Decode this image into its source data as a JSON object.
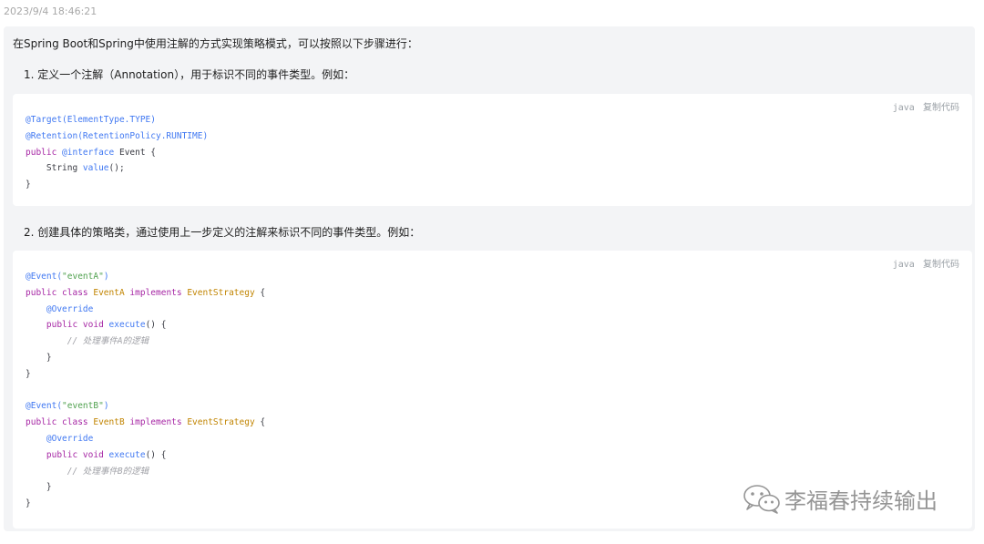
{
  "timestamp": "2023/9/4 18:46:21",
  "message": {
    "intro": "在Spring Boot和Spring中使用注解的方式实现策略模式，可以按照以下步骤进行：",
    "steps": [
      {
        "label": "1. 定义一个注解（Annotation），用于标识不同的事件类型。例如："
      },
      {
        "label": "2. 创建具体的策略类，通过使用上一步定义的注解来标识不同的事件类型。例如："
      }
    ],
    "code_blocks": [
      {
        "language": "java",
        "copy_label": "复制代码",
        "lines": [
          [
            [
              "t-anno",
              "@Target(ElementType.TYPE)"
            ]
          ],
          [
            [
              "t-anno",
              "@Retention(RetentionPolicy.RUNTIME)"
            ]
          ],
          [
            [
              "t-kw",
              "public "
            ],
            [
              "t-anno",
              "@interface"
            ],
            [
              "t-plain",
              " Event {"
            ]
          ],
          [
            [
              "t-plain",
              "    String "
            ],
            [
              "t-fn",
              "value"
            ],
            [
              "t-plain",
              "();"
            ]
          ],
          [
            [
              "t-plain",
              "}"
            ]
          ]
        ]
      },
      {
        "language": "java",
        "copy_label": "复制代码",
        "lines": [
          [
            [
              "t-anno",
              "@Event("
            ],
            [
              "t-str",
              "\"eventA\""
            ],
            [
              "t-anno",
              ")"
            ]
          ],
          [
            [
              "t-kw",
              "public class "
            ],
            [
              "t-type",
              "EventA"
            ],
            [
              "t-kw",
              " implements "
            ],
            [
              "t-type",
              "EventStrategy"
            ],
            [
              "t-plain",
              " {"
            ]
          ],
          [
            [
              "t-plain",
              "    "
            ],
            [
              "t-anno",
              "@Override"
            ]
          ],
          [
            [
              "t-plain",
              "    "
            ],
            [
              "t-kw",
              "public void "
            ],
            [
              "t-fn",
              "execute"
            ],
            [
              "t-plain",
              "() {"
            ]
          ],
          [
            [
              "t-plain",
              "        "
            ],
            [
              "t-cmt",
              "// 处理事件A的逻辑"
            ]
          ],
          [
            [
              "t-plain",
              "    }"
            ]
          ],
          [
            [
              "t-plain",
              "}"
            ]
          ],
          [
            [
              "t-plain",
              ""
            ]
          ],
          [
            [
              "t-anno",
              "@Event("
            ],
            [
              "t-str",
              "\"eventB\""
            ],
            [
              "t-anno",
              ")"
            ]
          ],
          [
            [
              "t-kw",
              "public class "
            ],
            [
              "t-type",
              "EventB"
            ],
            [
              "t-kw",
              " implements "
            ],
            [
              "t-type",
              "EventStrategy"
            ],
            [
              "t-plain",
              " {"
            ]
          ],
          [
            [
              "t-plain",
              "    "
            ],
            [
              "t-anno",
              "@Override"
            ]
          ],
          [
            [
              "t-plain",
              "    "
            ],
            [
              "t-kw",
              "public void "
            ],
            [
              "t-fn",
              "execute"
            ],
            [
              "t-plain",
              "() {"
            ]
          ],
          [
            [
              "t-plain",
              "        "
            ],
            [
              "t-cmt",
              "// 处理事件B的逻辑"
            ]
          ],
          [
            [
              "t-plain",
              "    }"
            ]
          ],
          [
            [
              "t-plain",
              "}"
            ]
          ]
        ]
      }
    ]
  },
  "watermark": {
    "text": "李福春持续输出",
    "icon": "wechat-icon"
  },
  "colors": {
    "message_bg": "#f3f4f6",
    "code_bg": "#ffffff",
    "annotation": "#4078f2",
    "keyword": "#a626a4",
    "type": "#c18401",
    "string": "#50a14f",
    "comment": "#a0a1a7"
  }
}
